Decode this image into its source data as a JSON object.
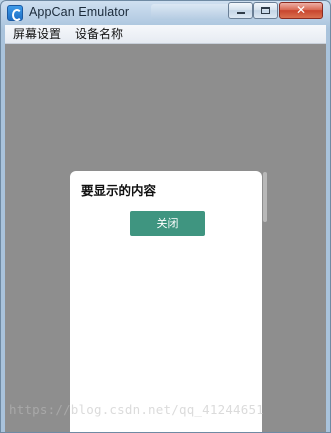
{
  "window": {
    "title": "AppCan Emulator",
    "icon": "appcan-icon",
    "controls": {
      "minimize": "minimize-icon",
      "maximize": "maximize-icon",
      "close_glyph": "✕"
    }
  },
  "menu": {
    "items": [
      {
        "label": "屏幕设置"
      },
      {
        "label": "设备名称"
      }
    ]
  },
  "dialog": {
    "message": "要显示的内容",
    "close_label": "关闭",
    "button_color": "#3f9580"
  },
  "colors": {
    "backdrop": "#8e8e8e",
    "dialog_bg": "#ffffff"
  },
  "watermark": {
    "text": "https://blog.csdn.net/qq_41244651"
  }
}
